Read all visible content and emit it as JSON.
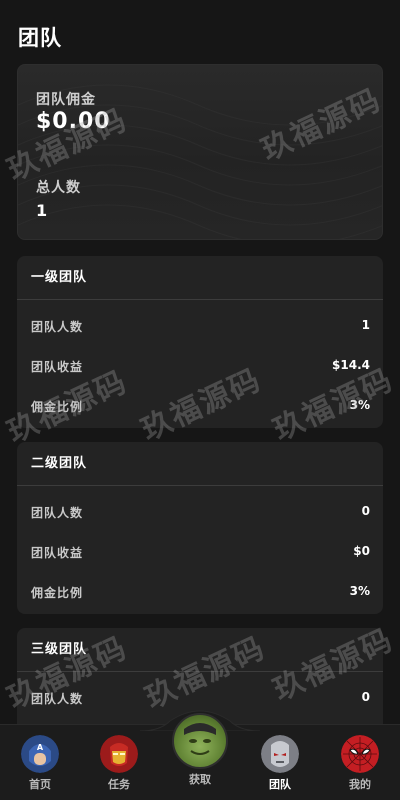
{
  "header": {
    "title": "团队"
  },
  "summary": {
    "commission_label": "团队佣金",
    "commission_value": "$0.00",
    "count_label": "总人数",
    "count_value": "1"
  },
  "levels": [
    {
      "title": "一级团队",
      "rows": [
        {
          "label": "团队人数",
          "value": "1"
        },
        {
          "label": "团队收益",
          "value": "$14.4"
        },
        {
          "label": "佣金比例",
          "value": "3%"
        }
      ]
    },
    {
      "title": "二级团队",
      "rows": [
        {
          "label": "团队人数",
          "value": "0"
        },
        {
          "label": "团队收益",
          "value": "$0"
        },
        {
          "label": "佣金比例",
          "value": "3%"
        }
      ]
    },
    {
      "title": "三级团队",
      "rows": [
        {
          "label": "团队人数",
          "value": "0"
        }
      ]
    }
  ],
  "watermark": "玖福源码",
  "tabbar": {
    "items": [
      {
        "label": "首页",
        "icon": "captain-america-avatar-icon"
      },
      {
        "label": "任务",
        "icon": "iron-man-avatar-icon"
      },
      {
        "label": "获取",
        "icon": "hulk-avatar-icon"
      },
      {
        "label": "团队",
        "icon": "ultron-avatar-icon"
      },
      {
        "label": "我的",
        "icon": "spider-man-avatar-icon"
      }
    ]
  },
  "colors": {
    "background": "#161616",
    "card": "#232323",
    "text": "#ffffff"
  }
}
